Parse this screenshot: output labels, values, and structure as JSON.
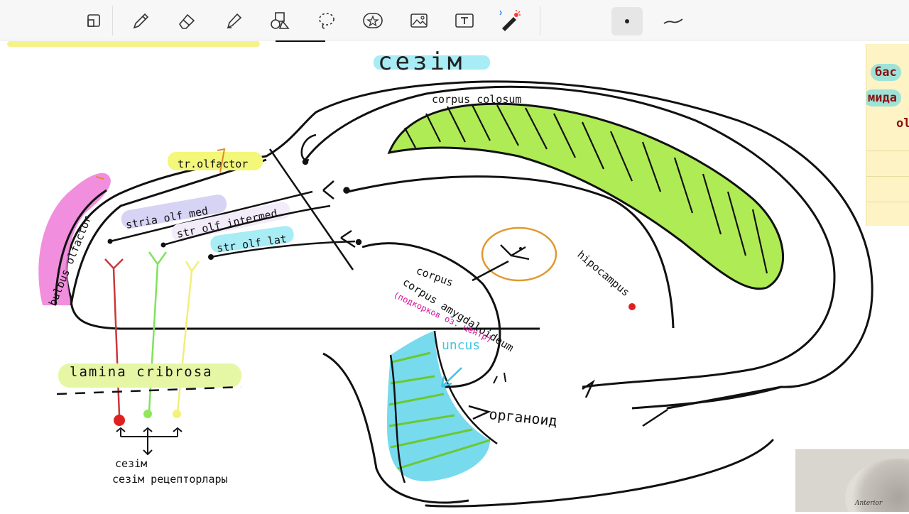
{
  "toolbar": {
    "tools": [
      {
        "name": "layout-icon",
        "active": false
      },
      {
        "name": "pen-icon",
        "active": false
      },
      {
        "name": "eraser-icon",
        "active": false
      },
      {
        "name": "highlighter-icon",
        "active": false
      },
      {
        "name": "shapes-icon",
        "active": false
      },
      {
        "name": "lasso-icon",
        "active": false
      },
      {
        "name": "sticker-icon",
        "active": false
      },
      {
        "name": "image-icon",
        "active": false
      },
      {
        "name": "text-icon",
        "active": false
      },
      {
        "name": "laser-pointer-icon",
        "active": false
      },
      {
        "name": "dot-pen-size-icon",
        "active": true
      },
      {
        "name": "stroke-style-icon",
        "active": false
      }
    ]
  },
  "diagram": {
    "title": "сезім",
    "corpus_callosum": "corpus colosum",
    "bulbus": "bulbus olfactor",
    "tract": "tr.olfactor",
    "stria_med": "stria olf med",
    "stria_intermed": "str olf intermed",
    "stria_lat": "str olf lat",
    "amygdala": "corpus amygdaloideum",
    "amygdala_note": "(подкорков оз. центр)",
    "uncus": "uncus",
    "hippocampus": "hipocampus",
    "lamina": "lamina cribrosa",
    "receptors": "сезім рецепторлары",
    "arrow_label": "органоид"
  },
  "sidenote": {
    "line1": "бас",
    "line2": "мида",
    "line3": "ol"
  },
  "thumbnail": {
    "caption": "Anterior"
  },
  "colors": {
    "green_fill": "#9be62b",
    "blue_fill": "#5fd3ea",
    "pink": "#f07ad8",
    "yellow": "#f3f77a",
    "lavender": "#d7d3f5",
    "cyan_highlight": "#a8ecf5",
    "orange": "#e0992f",
    "magenta_text": "#d8149c",
    "red_dot": "#e02020",
    "green_dot": "#8fe85a",
    "yellow_dot": "#f5f27a"
  }
}
